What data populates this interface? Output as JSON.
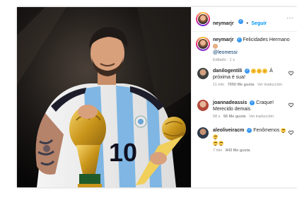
{
  "header": {
    "username": "neymarjr",
    "separator": "•",
    "follow_label": "Seguir",
    "more_label": "···"
  },
  "caption": {
    "username": "neymarjr",
    "text": "Felicidades Hermano",
    "mention": "@leomessi",
    "meta": "Editado · 1 s"
  },
  "comments": [
    {
      "username": "danilogentili",
      "text": "À próxima é sua!",
      "meta": {
        "time": "11 min",
        "likes": "7050 Me gusta",
        "reply": "Ver traducción"
      }
    },
    {
      "username": "joannadeassis",
      "text": "Craque! Merecido demais",
      "meta": {
        "time": "58 s",
        "likes": "56 Me gusta",
        "reply": "Ver traducción"
      }
    },
    {
      "username": "aleoliveiracm",
      "text": "Fenômenos",
      "meta": {
        "time": "7 min",
        "likes": "843 Me gusta",
        "reply": ""
      }
    }
  ],
  "photo": {
    "jersey_number": "10"
  },
  "colors": {
    "verified": "#3897f0",
    "follow": "#0095f6",
    "meta": "#8e8e8e",
    "jersey_blue": "#7fb6e3",
    "trophy_gold": "#d4a017"
  },
  "icons": {
    "verified": "verified-badge-icon",
    "heart": "heart-icon",
    "more": "more-options-icon"
  }
}
